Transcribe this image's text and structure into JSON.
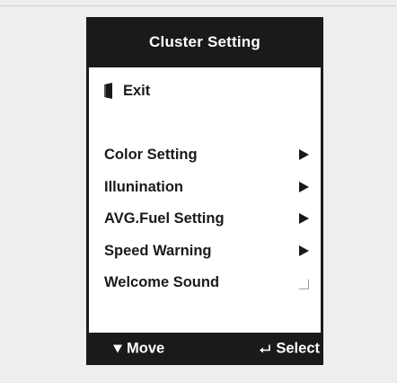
{
  "panel": {
    "title": "Cluster Setting"
  },
  "menu": {
    "exit": {
      "label": "Exit",
      "icon": "door-icon"
    },
    "items": [
      {
        "label": "Color Setting",
        "icon": "arrow-right-icon"
      },
      {
        "label": "Illunination",
        "icon": "arrow-right-icon"
      },
      {
        "label": "AVG.Fuel Setting",
        "icon": "arrow-right-icon"
      },
      {
        "label": "Speed Warning",
        "icon": "arrow-right-icon"
      },
      {
        "label": "Welcome Sound",
        "control": "checkbox",
        "checked": false
      }
    ]
  },
  "footer": {
    "move_label": "Move",
    "move_icon": "triangle-down-icon",
    "select_label": "Select",
    "select_icon": "enter-icon"
  },
  "colors": {
    "panel": "#1a1a1a",
    "body": "#ffffff",
    "background": "#eeeeee"
  }
}
